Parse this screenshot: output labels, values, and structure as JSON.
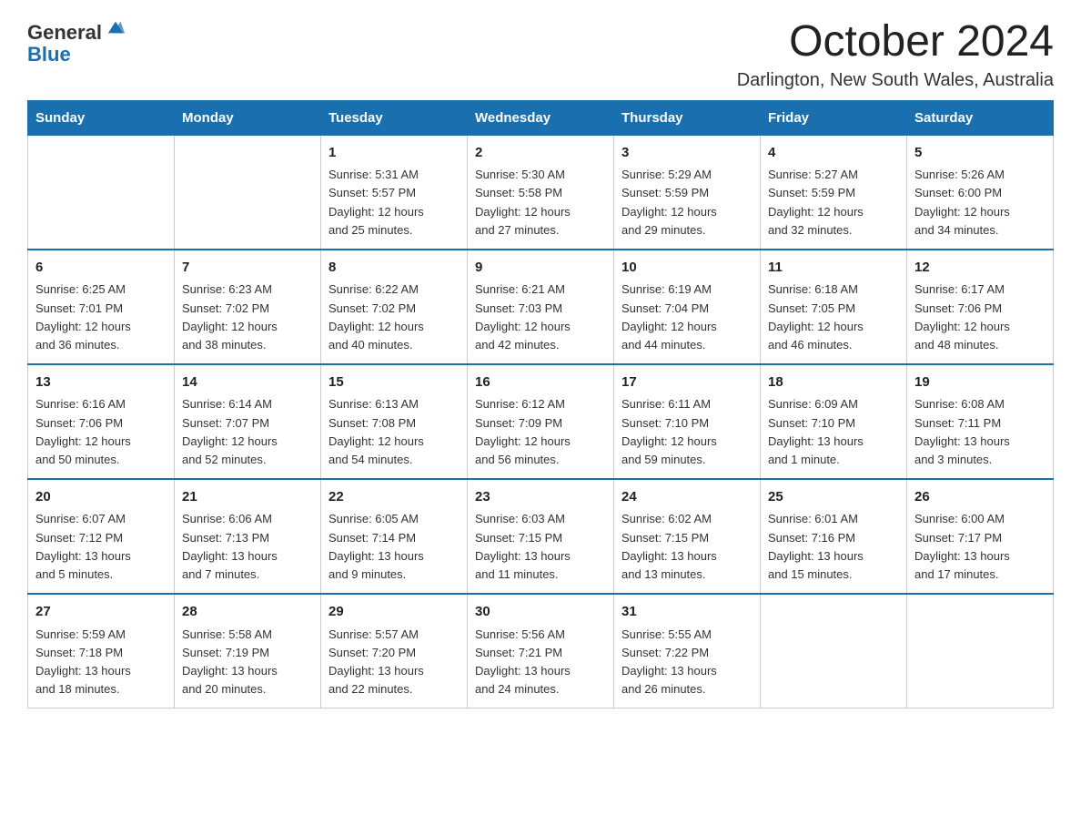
{
  "header": {
    "logo_general": "General",
    "logo_blue": "Blue",
    "month_year": "October 2024",
    "location": "Darlington, New South Wales, Australia"
  },
  "weekdays": [
    "Sunday",
    "Monday",
    "Tuesday",
    "Wednesday",
    "Thursday",
    "Friday",
    "Saturday"
  ],
  "weeks": [
    [
      {
        "day": "",
        "info": ""
      },
      {
        "day": "",
        "info": ""
      },
      {
        "day": "1",
        "info": "Sunrise: 5:31 AM\nSunset: 5:57 PM\nDaylight: 12 hours\nand 25 minutes."
      },
      {
        "day": "2",
        "info": "Sunrise: 5:30 AM\nSunset: 5:58 PM\nDaylight: 12 hours\nand 27 minutes."
      },
      {
        "day": "3",
        "info": "Sunrise: 5:29 AM\nSunset: 5:59 PM\nDaylight: 12 hours\nand 29 minutes."
      },
      {
        "day": "4",
        "info": "Sunrise: 5:27 AM\nSunset: 5:59 PM\nDaylight: 12 hours\nand 32 minutes."
      },
      {
        "day": "5",
        "info": "Sunrise: 5:26 AM\nSunset: 6:00 PM\nDaylight: 12 hours\nand 34 minutes."
      }
    ],
    [
      {
        "day": "6",
        "info": "Sunrise: 6:25 AM\nSunset: 7:01 PM\nDaylight: 12 hours\nand 36 minutes."
      },
      {
        "day": "7",
        "info": "Sunrise: 6:23 AM\nSunset: 7:02 PM\nDaylight: 12 hours\nand 38 minutes."
      },
      {
        "day": "8",
        "info": "Sunrise: 6:22 AM\nSunset: 7:02 PM\nDaylight: 12 hours\nand 40 minutes."
      },
      {
        "day": "9",
        "info": "Sunrise: 6:21 AM\nSunset: 7:03 PM\nDaylight: 12 hours\nand 42 minutes."
      },
      {
        "day": "10",
        "info": "Sunrise: 6:19 AM\nSunset: 7:04 PM\nDaylight: 12 hours\nand 44 minutes."
      },
      {
        "day": "11",
        "info": "Sunrise: 6:18 AM\nSunset: 7:05 PM\nDaylight: 12 hours\nand 46 minutes."
      },
      {
        "day": "12",
        "info": "Sunrise: 6:17 AM\nSunset: 7:06 PM\nDaylight: 12 hours\nand 48 minutes."
      }
    ],
    [
      {
        "day": "13",
        "info": "Sunrise: 6:16 AM\nSunset: 7:06 PM\nDaylight: 12 hours\nand 50 minutes."
      },
      {
        "day": "14",
        "info": "Sunrise: 6:14 AM\nSunset: 7:07 PM\nDaylight: 12 hours\nand 52 minutes."
      },
      {
        "day": "15",
        "info": "Sunrise: 6:13 AM\nSunset: 7:08 PM\nDaylight: 12 hours\nand 54 minutes."
      },
      {
        "day": "16",
        "info": "Sunrise: 6:12 AM\nSunset: 7:09 PM\nDaylight: 12 hours\nand 56 minutes."
      },
      {
        "day": "17",
        "info": "Sunrise: 6:11 AM\nSunset: 7:10 PM\nDaylight: 12 hours\nand 59 minutes."
      },
      {
        "day": "18",
        "info": "Sunrise: 6:09 AM\nSunset: 7:10 PM\nDaylight: 13 hours\nand 1 minute."
      },
      {
        "day": "19",
        "info": "Sunrise: 6:08 AM\nSunset: 7:11 PM\nDaylight: 13 hours\nand 3 minutes."
      }
    ],
    [
      {
        "day": "20",
        "info": "Sunrise: 6:07 AM\nSunset: 7:12 PM\nDaylight: 13 hours\nand 5 minutes."
      },
      {
        "day": "21",
        "info": "Sunrise: 6:06 AM\nSunset: 7:13 PM\nDaylight: 13 hours\nand 7 minutes."
      },
      {
        "day": "22",
        "info": "Sunrise: 6:05 AM\nSunset: 7:14 PM\nDaylight: 13 hours\nand 9 minutes."
      },
      {
        "day": "23",
        "info": "Sunrise: 6:03 AM\nSunset: 7:15 PM\nDaylight: 13 hours\nand 11 minutes."
      },
      {
        "day": "24",
        "info": "Sunrise: 6:02 AM\nSunset: 7:15 PM\nDaylight: 13 hours\nand 13 minutes."
      },
      {
        "day": "25",
        "info": "Sunrise: 6:01 AM\nSunset: 7:16 PM\nDaylight: 13 hours\nand 15 minutes."
      },
      {
        "day": "26",
        "info": "Sunrise: 6:00 AM\nSunset: 7:17 PM\nDaylight: 13 hours\nand 17 minutes."
      }
    ],
    [
      {
        "day": "27",
        "info": "Sunrise: 5:59 AM\nSunset: 7:18 PM\nDaylight: 13 hours\nand 18 minutes."
      },
      {
        "day": "28",
        "info": "Sunrise: 5:58 AM\nSunset: 7:19 PM\nDaylight: 13 hours\nand 20 minutes."
      },
      {
        "day": "29",
        "info": "Sunrise: 5:57 AM\nSunset: 7:20 PM\nDaylight: 13 hours\nand 22 minutes."
      },
      {
        "day": "30",
        "info": "Sunrise: 5:56 AM\nSunset: 7:21 PM\nDaylight: 13 hours\nand 24 minutes."
      },
      {
        "day": "31",
        "info": "Sunrise: 5:55 AM\nSunset: 7:22 PM\nDaylight: 13 hours\nand 26 minutes."
      },
      {
        "day": "",
        "info": ""
      },
      {
        "day": "",
        "info": ""
      }
    ]
  ]
}
